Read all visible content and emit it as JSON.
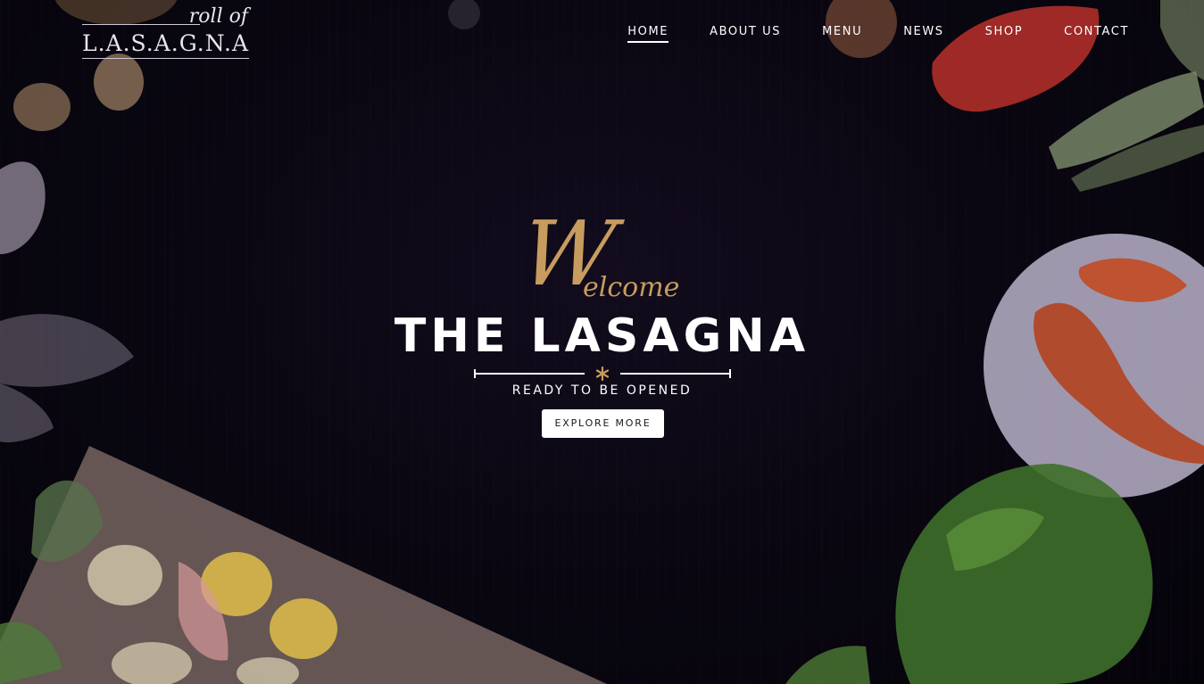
{
  "logo": {
    "script": "roll of",
    "main": "L.A.S.A.G.N.A"
  },
  "nav": {
    "items": [
      {
        "label": "HOME",
        "active": true
      },
      {
        "label": "ABOUT US",
        "active": false
      },
      {
        "label": "MENU",
        "active": false
      },
      {
        "label": "NEWS",
        "active": false
      },
      {
        "label": "SHOP",
        "active": false
      },
      {
        "label": "CONTACT",
        "active": false
      }
    ]
  },
  "hero": {
    "welcome_initial": "W",
    "welcome_rest": "elcome",
    "title": "THE LASAGNA",
    "subtitle": "READY TO BE OPENED",
    "button_label": "EXPLORE MORE"
  },
  "colors": {
    "accent_gold": "#c79c5e",
    "background": "#07050d",
    "text": "#ffffff"
  }
}
